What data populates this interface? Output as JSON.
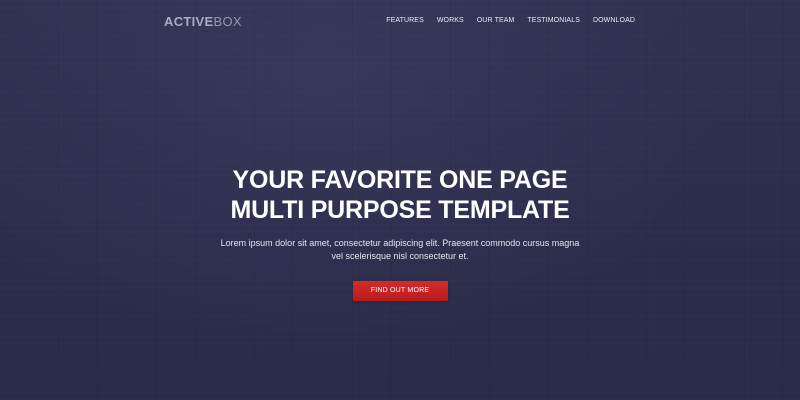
{
  "header": {
    "logo_strong": "ACTIVE",
    "logo_light": "BOX",
    "nav": [
      "FEATURES",
      "WORKS",
      "OUR TEAM",
      "TESTIMONIALS",
      "DOWNLOAD"
    ]
  },
  "hero": {
    "headline_line1": "YOUR FAVORITE ONE PAGE",
    "headline_line2": "MULTI PURPOSE TEMPLATE",
    "subtext_line1": "Lorem ipsum dolor sit amet, consectetur adipiscing elit. Praesent commodo cursus magna",
    "subtext_line2": "vel scelerisque nisl consectetur et.",
    "cta_label": "FIND OUT MORE"
  },
  "colors": {
    "background": "#2d2e4c",
    "cta": "#c92222",
    "text": "#ffffff"
  }
}
